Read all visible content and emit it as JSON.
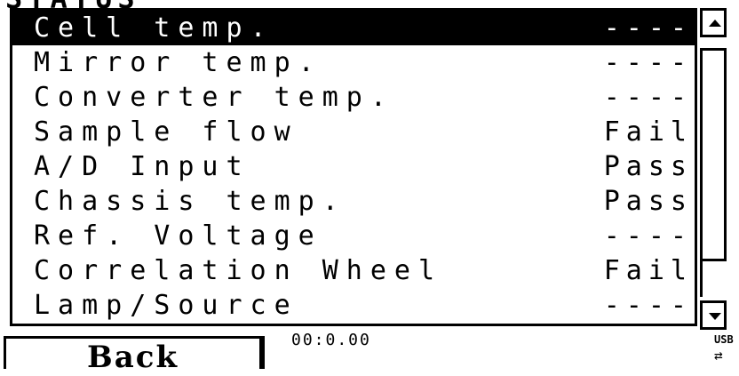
{
  "header": {
    "title_fragment": "STATUS"
  },
  "status_items": [
    {
      "label": "Cell temp.",
      "value": "----",
      "selected": true
    },
    {
      "label": "Mirror temp.",
      "value": "----"
    },
    {
      "label": "Converter temp.",
      "value": "----"
    },
    {
      "label": "Sample flow",
      "value": "Fail"
    },
    {
      "label": "A/D Input",
      "value": "Pass"
    },
    {
      "label": "Chassis temp.",
      "value": "Pass"
    },
    {
      "label": "Ref. Voltage",
      "value": "----"
    },
    {
      "label": "Correlation Wheel",
      "value": "Fail"
    },
    {
      "label": "Lamp/Source",
      "value": "----"
    }
  ],
  "footer": {
    "back_label": "Back",
    "time": "00:0.00",
    "usb_label": "USB"
  },
  "icons": {
    "scroll_up": "triangle-up-icon",
    "scroll_down": "triangle-down-icon",
    "usb": "usb-arrows-icon"
  }
}
